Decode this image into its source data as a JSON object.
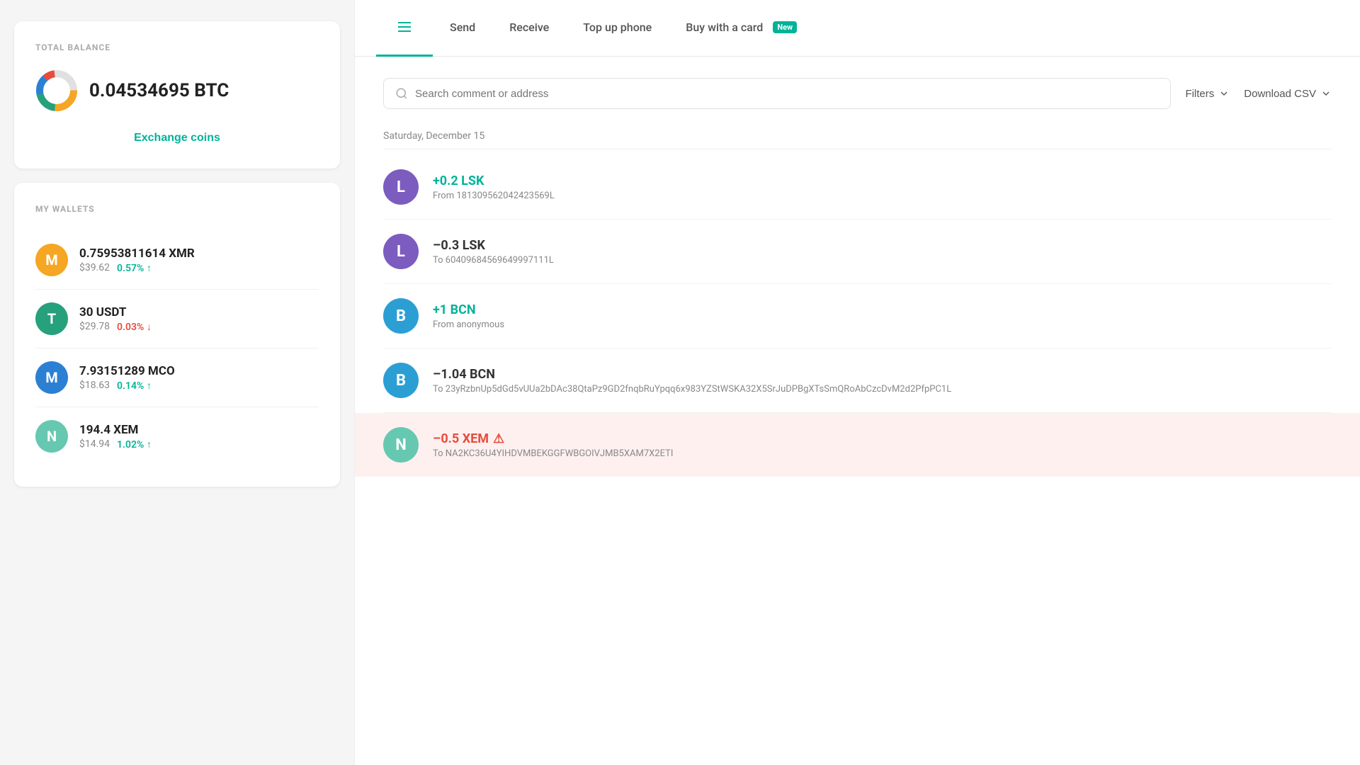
{
  "leftPanel": {
    "totalBalance": {
      "title": "TOTAL BALANCE",
      "amount": "0.04534695 BTC",
      "exchangeLabel": "Exchange coins"
    },
    "myWallets": {
      "title": "MY WALLETS",
      "wallets": [
        {
          "symbol": "XMR",
          "amount": "0.75953811614 XMR",
          "usd": "$39.62",
          "change": "0.57% ↑",
          "direction": "up",
          "iconColor": "#f5a623",
          "iconLetter": "M"
        },
        {
          "symbol": "USDT",
          "amount": "30 USDT",
          "usd": "$29.78",
          "change": "0.03% ↓",
          "direction": "down",
          "iconColor": "#26a17b",
          "iconLetter": "T"
        },
        {
          "symbol": "MCO",
          "amount": "7.93151289 MCO",
          "usd": "$18.63",
          "change": "0.14% ↑",
          "direction": "up",
          "iconColor": "#2b80d3",
          "iconLetter": "M"
        },
        {
          "symbol": "XEM",
          "amount": "194.4 XEM",
          "usd": "$14.94",
          "change": "1.02% ↑",
          "direction": "up",
          "iconColor": "#67c8b1",
          "iconLetter": "N"
        }
      ]
    }
  },
  "rightPanel": {
    "tabs": [
      {
        "id": "history",
        "label": "",
        "icon": "list",
        "active": true
      },
      {
        "id": "send",
        "label": "Send",
        "active": false
      },
      {
        "id": "receive",
        "label": "Receive",
        "active": false
      },
      {
        "id": "topup",
        "label": "Top up phone",
        "active": false
      },
      {
        "id": "buy",
        "label": "Buy with a card",
        "badge": "New",
        "active": false
      }
    ],
    "searchPlaceholder": "Search comment or address",
    "filtersLabel": "Filters",
    "csvLabel": "Download CSV",
    "dateLabel": "Saturday, December 15",
    "transactions": [
      {
        "id": "tx1",
        "amountLabel": "+0.2 LSK",
        "type": "positive",
        "description": "From 181309562042423569L",
        "iconColor": "#7c5cbf",
        "iconLetter": "L"
      },
      {
        "id": "tx2",
        "amountLabel": "–0.3 LSK",
        "type": "negative",
        "description": "To 60409684569649997111L",
        "iconColor": "#7c5cbf",
        "iconLetter": "L"
      },
      {
        "id": "tx3",
        "amountLabel": "+1 BCN",
        "type": "positive",
        "description": "From anonymous",
        "iconColor": "#2b9fd4",
        "iconLetter": "B"
      },
      {
        "id": "tx4",
        "amountLabel": "–1.04 BCN",
        "type": "negative",
        "description": "To 23yRzbnUp5dGd5vUUa2bDAc38QtaPz9GD2fnqbRuYpqq6x983YZStWSKA32X5SrJuDPBgXTsSmQRoAbCzcDvM2d2PfpPC1L",
        "iconColor": "#2b9fd4",
        "iconLetter": "B"
      },
      {
        "id": "tx5",
        "amountLabel": "–0.5 XEM",
        "type": "error",
        "description": "To NA2KC36U4YIHDVMBEKGGFWBGOIVJMB5XAM7X2ETI",
        "iconColor": "#67c8b1",
        "iconLetter": "N",
        "highlighted": true,
        "hasWarning": true
      }
    ]
  }
}
